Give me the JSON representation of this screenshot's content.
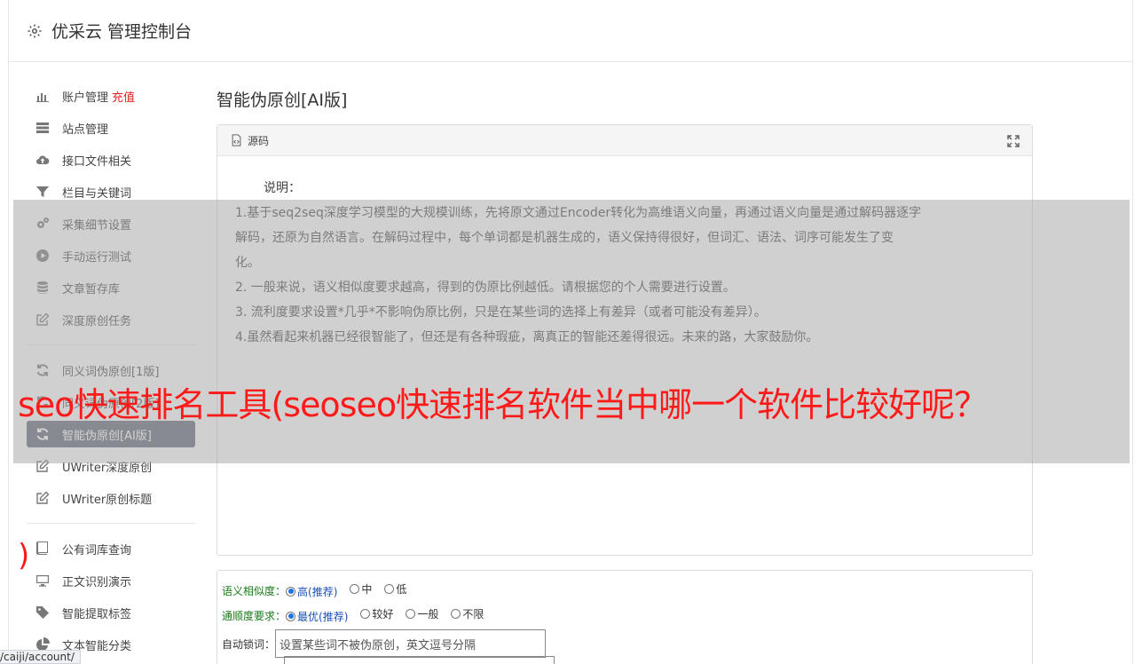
{
  "header": {
    "title": "优采云 管理控制台",
    "icon": "gear-icon"
  },
  "sidebar": {
    "group1": [
      {
        "label": "账户管理",
        "badge": "充值",
        "icon": "bar-chart-icon"
      },
      {
        "label": "站点管理",
        "icon": "list-icon"
      },
      {
        "label": "接口文件相关",
        "icon": "cloud-upload-icon"
      },
      {
        "label": "栏目与关键词",
        "icon": "filter-icon"
      },
      {
        "label": "采集细节设置",
        "icon": "cogs-icon"
      },
      {
        "label": "手动运行测试",
        "icon": "play-icon"
      },
      {
        "label": "文章暂存库",
        "icon": "database-icon"
      },
      {
        "label": "深度原创任务",
        "icon": "edit-icon"
      }
    ],
    "group2": [
      {
        "label": "同义词伪原创[1版]",
        "icon": "refresh-icon"
      },
      {
        "label": "同义词伪原创[2版]",
        "icon": "refresh-icon"
      },
      {
        "label": "智能伪原创[AI版]",
        "icon": "refresh-icon",
        "active": true
      },
      {
        "label": "UWriter深度原创",
        "icon": "edit-icon"
      },
      {
        "label": "UWriter原创标题",
        "icon": "edit-icon"
      }
    ],
    "group3": [
      {
        "label": "公有词库查询",
        "icon": "book-icon"
      },
      {
        "label": "正文识别演示",
        "icon": "monitor-icon"
      },
      {
        "label": "智能提取标签",
        "icon": "tag-icon"
      },
      {
        "label": "文本智能分类",
        "icon": "pie-chart-icon"
      }
    ]
  },
  "main": {
    "title": "智能伪原创[AI版]",
    "panel": {
      "head_label": "源码",
      "explain_title": "说明：",
      "lines": [
        "1.基于seq2seq深度学习模型的大规模训练，先将原文通过Encoder转化为高维语义向量，再通过语义向量是通过解码器逐字",
        "解码，还原为自然语言。在解码过程中，每个单词都是机器生成的，语义保持得很好，但词汇、语法、词序可能发生了变",
        "化。",
        "2. 一般来说，语义相似度要求越高，得到的伪原比例越低。请根据您的个人需要进行设置。",
        "3. 流利度要求设置*几乎*不影响伪原比例，只是在某些词的选择上有差异（或者可能没有差异）。",
        "4.虽然看起来机器已经很智能了，但还是有各种瑕疵，离真正的智能还差得很远。未来的路，大家鼓励你。"
      ]
    },
    "form": {
      "similarity_label": "语义相似度：",
      "similarity_options": [
        "高(推荐)",
        "中",
        "低"
      ],
      "fluency_label": "通顺度要求：",
      "fluency_options": [
        "最优(推荐)",
        "较好",
        "一般",
        "不限"
      ],
      "lock_label": "自动锁词：",
      "lock_placeholder": "设置某些词不被伪原创，英文逗号分隔"
    }
  },
  "overlay": {
    "headline": "seo快速排名工具(seoseo快速排名软件当中哪一个软件比较好呢？",
    "paren": ")"
  },
  "status_url": "/caiji/account/"
}
